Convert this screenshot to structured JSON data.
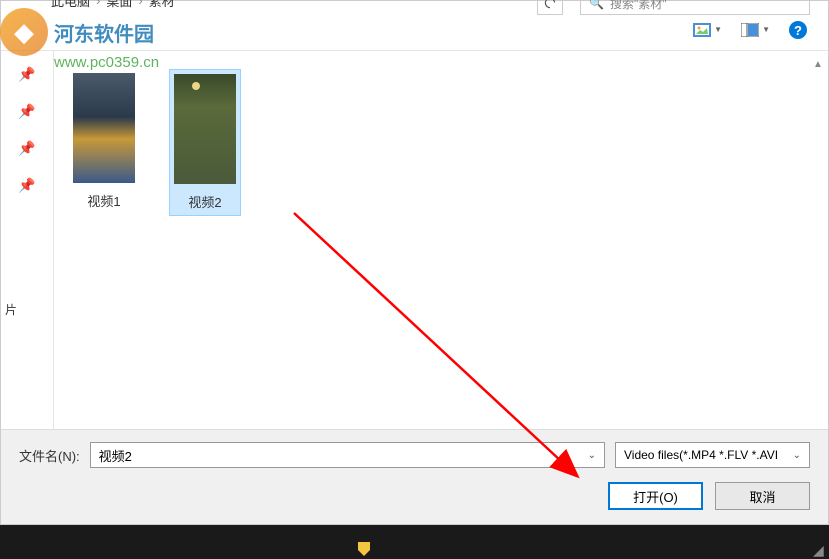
{
  "breadcrumb": {
    "part1": "此电脑",
    "part2": "桌面",
    "part3": "素材"
  },
  "search": {
    "placeholder": "搜索\"素材\""
  },
  "sidebar": {
    "label_pic": "片"
  },
  "files": [
    {
      "label": "视频1",
      "selected": false
    },
    {
      "label": "视频2",
      "selected": true
    }
  ],
  "bottom": {
    "filename_label": "文件名(N):",
    "filename_value": "视频2",
    "filter_value": "Video files(*.MP4 *.FLV *.AVI",
    "open_label": "打开(O)",
    "cancel_label": "取消"
  },
  "watermark": {
    "site": "河东软件园",
    "url": "www.pc0359.cn"
  }
}
